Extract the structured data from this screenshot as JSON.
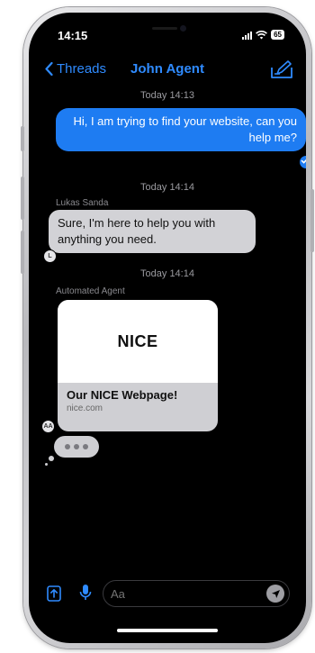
{
  "status": {
    "time": "14:15",
    "battery": "65"
  },
  "nav": {
    "back_label": "Threads",
    "title": "John Agent"
  },
  "messages": {
    "ts1": "Today 14:13",
    "outgoing_text": "Hi, I am trying to find your website, can you help me?",
    "ts2": "Today 14:14",
    "sender1": "Lukas Sanda",
    "incoming_text": "Sure, I'm here to help you with anything you need.",
    "avatar1": "L",
    "ts3": "Today 14:14",
    "sender2": "Automated Agent",
    "card": {
      "logo": "NICE",
      "title": "Our NICE Webpage!",
      "domain": "nice.com"
    },
    "avatar2": "AA"
  },
  "composer": {
    "placeholder": "Aa"
  },
  "colors": {
    "accent": "#2f8bff",
    "outgoing_bubble": "#1e7cf2",
    "incoming_bubble": "#d2d2d6"
  }
}
